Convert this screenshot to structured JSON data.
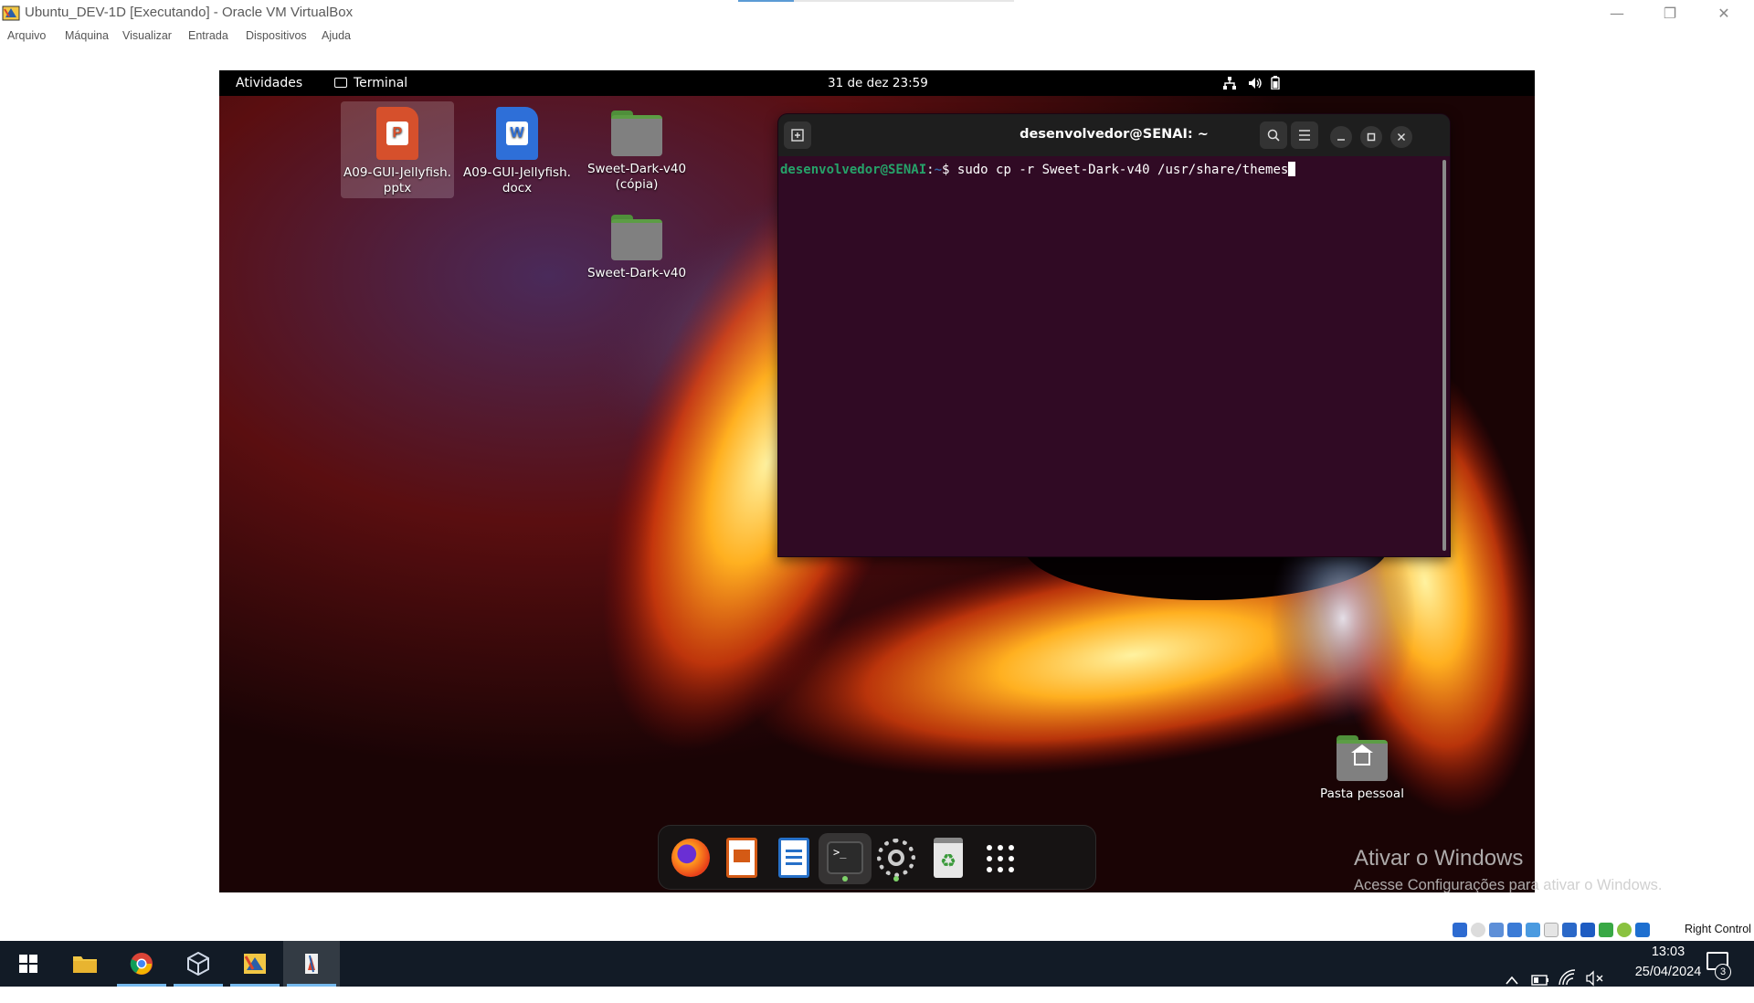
{
  "window": {
    "title": "Ubuntu_DEV-1D [Executando] - Oracle VM VirtualBox",
    "controls": {
      "minimize": "—",
      "restore": "❐",
      "close": "✕"
    }
  },
  "menubar": [
    "Arquivo",
    "Máquina",
    "Visualizar",
    "Entrada",
    "Dispositivos",
    "Ajuda"
  ],
  "guest": {
    "topbar": {
      "activities": "Atividades",
      "app_name": "Terminal",
      "clock": "31 de dez  23:59",
      "icons": [
        "network-icon",
        "volume-icon",
        "battery-icon"
      ]
    },
    "desktop_icons": [
      {
        "label_line1": "A09-GUI-Jellyfish.",
        "label_line2": "pptx",
        "kind": "presentation-file",
        "selected": true
      },
      {
        "label_line1": "A09-GUI-Jellyfish.",
        "label_line2": "docx",
        "kind": "document-file",
        "selected": false
      },
      {
        "label_line1": "Sweet-Dark-v40",
        "label_line2": "(cópia)",
        "kind": "folder",
        "selected": false
      },
      {
        "label_line1": "Sweet-Dark-v40",
        "label_line2": "",
        "kind": "folder",
        "selected": false
      },
      {
        "label_line1": "Pasta pessoal",
        "label_line2": "",
        "kind": "home-folder",
        "selected": false
      }
    ],
    "terminal": {
      "title": "desenvolvedor@SENAI: ~",
      "prompt_user": "desenvolvedor@SENAI",
      "prompt_sep": ":",
      "prompt_path": "~",
      "prompt_symbol": "$",
      "command": " sudo cp -r Sweet-Dark-v40 /usr/share/themes"
    },
    "dock": [
      {
        "name": "firefox",
        "running": false
      },
      {
        "name": "libreoffice-impress",
        "running": false
      },
      {
        "name": "libreoffice-writer",
        "running": false
      },
      {
        "name": "terminal",
        "running": true,
        "active": true
      },
      {
        "name": "settings",
        "running": true
      },
      {
        "name": "trash",
        "running": false
      },
      {
        "name": "show-applications",
        "running": false
      }
    ],
    "activation": {
      "title": "Ativar o Windows",
      "subtitle": "Acesse Configurações para ativar o Windows."
    }
  },
  "vb_status": {
    "host_key": "Right Control"
  },
  "taskbar": {
    "apps": [
      "start",
      "file-explorer",
      "chrome",
      "virtualbox-manager",
      "sublime-like-editor",
      "virtualbox-vm"
    ],
    "clock_time": "13:03",
    "clock_date": "25/04/2024",
    "notification_count": "3"
  },
  "colors": {
    "terminal_bg": "#300a24",
    "prompt_user": "#26a269",
    "prompt_path": "#3465a4",
    "taskbar_bg": "#121b26",
    "taskbar_accent": "#76b9ed"
  }
}
